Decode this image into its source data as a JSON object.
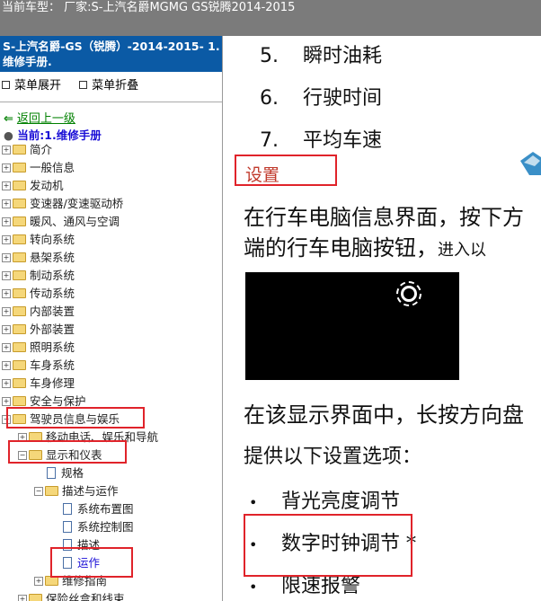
{
  "topbar": {
    "text": "当前车型：   厂家:S-上汽名爵MGMG GS锐腾2014-2015"
  },
  "sidebar": {
    "title": "S-上汽名爵-GS（锐腾）-2014-2015- 1.维修手册.",
    "expand_label": "菜单展开",
    "collapse_label": "菜单折叠",
    "back_label": "返回上一级",
    "current_label": "当前:1.维修手册",
    "tree": [
      "简介",
      "一般信息",
      "发动机",
      "变速器/变速驱动桥",
      "暖风、通风与空调",
      "转向系统",
      "悬架系统",
      "制动系统",
      "传动系统",
      "内部装置",
      "外部装置",
      "照明系统",
      "车身系统",
      "车身修理",
      "安全与保护",
      "驾驶员信息与娱乐"
    ],
    "sub1": "移动电话、娱乐和导航",
    "sub2": "显示和仪表",
    "sub3": "规格",
    "sub4": "描述与运作",
    "sub5": "系统布置图",
    "sub6": "系统控制图",
    "sub7": "描述",
    "sub8": "运作",
    "sub9": "维修指南",
    "sub10": "保险丝盒和线束"
  },
  "content": {
    "items": [
      {
        "num": "5.",
        "text": "瞬时油耗"
      },
      {
        "num": "6.",
        "text": "行驶时间"
      },
      {
        "num": "7.",
        "text": "平均车速"
      }
    ],
    "section_title": "设置",
    "para1_line1": "在行车电脑信息界面，按下方",
    "para1_line2a": "端的行车电脑按钮，",
    "para1_line2b": "进入以",
    "para2": "在该显示界面中，长按方向盘",
    "para3": "提供以下设置选项：",
    "bullets": [
      "背光亮度调节",
      "数字时钟调节  *",
      "限速报警"
    ]
  },
  "colors": {
    "topbar": "#7b7b7b",
    "sidebar_title": "#0b5aa5",
    "highlight": "#e0232a",
    "section": "#c0392b"
  }
}
